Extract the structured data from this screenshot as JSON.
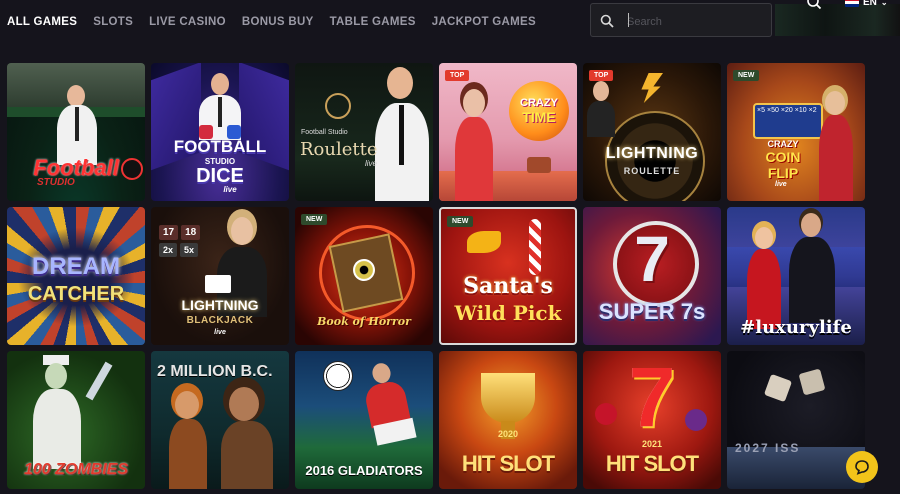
{
  "nav": {
    "tabs": [
      "ALL GAMES",
      "SLOTS",
      "LIVE CASINO",
      "BONUS BUY",
      "TABLE GAMES",
      "JACKPOT GAMES"
    ],
    "active": "ALL GAMES"
  },
  "search": {
    "placeholder": "Search",
    "icon": "search-icon"
  },
  "header": {
    "language": "EN"
  },
  "badges": {
    "top": "TOP",
    "new": "NEW"
  },
  "games": {
    "football_studio": {
      "title_line1": "Football",
      "title_line2": "STUDIO"
    },
    "football_dice": {
      "title_line1": "FOOTBALL",
      "title_line2": "STUDIO",
      "title_line3": "DICE",
      "tag": "live"
    },
    "roulette": {
      "provider": "Football Studio",
      "title": "Roulette",
      "tag": "live"
    },
    "crazy_time": {
      "title_line1": "CRAZY",
      "title_line2": "TIME",
      "badge": "TOP"
    },
    "lightning_roulette": {
      "title_line1": "LIGHTNING",
      "title_line2": "ROULETTE",
      "badge": "TOP"
    },
    "coin_flip": {
      "title_line1": "CRAZY",
      "title_line2": "COIN",
      "title_line3": "FLIP",
      "tag": "live",
      "badge": "NEW",
      "multipliers": [
        "×5",
        "×50",
        "×20",
        "×10",
        "×2"
      ]
    },
    "dream_catcher": {
      "title_line1": "DREAM",
      "title_line2": "CATCHER"
    },
    "lightning_blackjack": {
      "title_line1": "LIGHTNING",
      "title_line2": "BLACKJACK",
      "tag": "live",
      "chips": [
        "17",
        "18",
        "2x",
        "5x"
      ]
    },
    "book_of_horror": {
      "title": "Book of Horror",
      "badge": "NEW"
    },
    "santas_wild_pick": {
      "title_line1": "Santa's",
      "title_line2": "Wild Pick",
      "badge": "NEW"
    },
    "super_7s": {
      "title": "SUPER 7s"
    },
    "luxurylife": {
      "title": "#luxurylife"
    },
    "zombies": {
      "title": "100 ZOMBIES"
    },
    "million_bc": {
      "title": "2 MILLION B.C."
    },
    "gladiators": {
      "title": "2016 GLADIATORS"
    },
    "hit_slot_2020": {
      "title": "HIT SLOT",
      "year": "2020"
    },
    "hit_slot_2021": {
      "title": "HIT SLOT",
      "year": "2021"
    },
    "iss_2027": {
      "title": "2027 ISS"
    }
  },
  "colors": {
    "background": "#15141c",
    "accent": "#f2c41a",
    "badge_top": "#e23a2c",
    "badge_new": "#2e4a2c"
  }
}
